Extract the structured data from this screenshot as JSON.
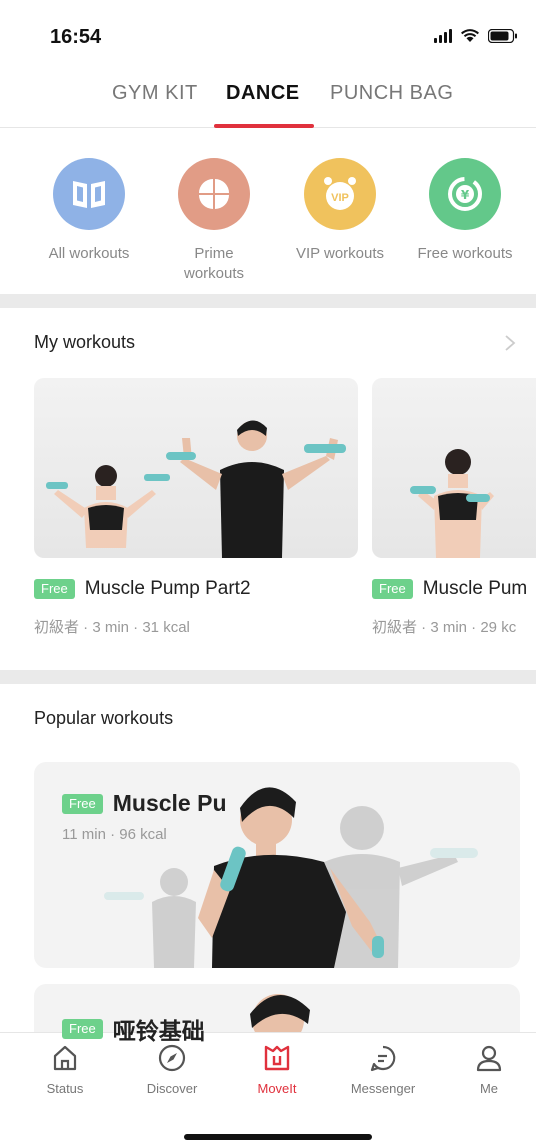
{
  "status": {
    "time": "16:54"
  },
  "tabs": [
    {
      "label": "GYM KIT"
    },
    {
      "label": "DANCE"
    },
    {
      "label": "PUNCH BAG"
    }
  ],
  "categories": [
    {
      "label": "All workouts",
      "icon": "book-icon",
      "color": "#8fb2e6"
    },
    {
      "label": "Prime workouts",
      "icon": "clover-icon",
      "color": "#e19c86"
    },
    {
      "label": "VIP workouts",
      "icon": "vip-alarm-icon",
      "color": "#f0c25d"
    },
    {
      "label": "Free workouts",
      "icon": "yen-coin-icon",
      "color": "#63c88a"
    }
  ],
  "my_workouts": {
    "title": "My workouts",
    "items": [
      {
        "badge": "Free",
        "title": "Muscle Pump Part2",
        "meta": "初級者 · 3 min · 31 kcal"
      },
      {
        "badge": "Free",
        "title": "Muscle Pum",
        "meta": "初級者 · 3 min · 29 kc"
      }
    ]
  },
  "popular_workouts": {
    "title": "Popular workouts",
    "items": [
      {
        "badge": "Free",
        "title": "Muscle Pu",
        "meta": "11 min · 96 kcal"
      },
      {
        "badge": "Free",
        "title": "哑铃基础"
      }
    ]
  },
  "nav": [
    {
      "label": "Status",
      "icon": "house-icon"
    },
    {
      "label": "Discover",
      "icon": "compass-icon"
    },
    {
      "label": "MoveIt",
      "icon": "moveit-icon"
    },
    {
      "label": "Messenger",
      "icon": "chat-icon"
    },
    {
      "label": "Me",
      "icon": "person-icon"
    }
  ],
  "colors": {
    "accent": "#e0313d",
    "free_badge": "#6dd18b"
  }
}
